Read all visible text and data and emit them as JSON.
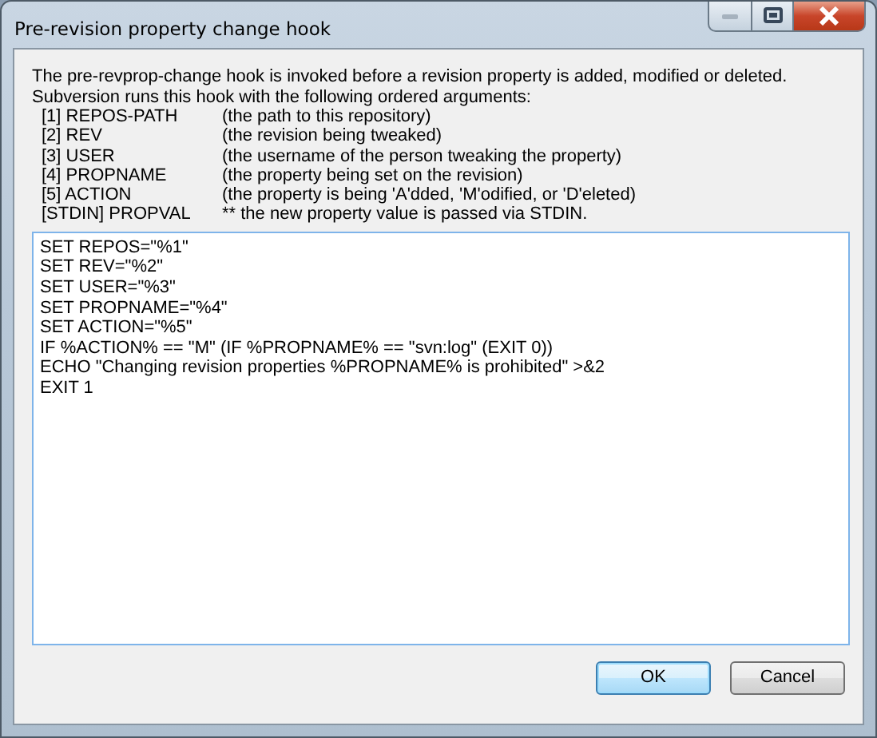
{
  "window": {
    "title": "Pre-revision property change hook",
    "controls": [
      {
        "kind": "minimize",
        "disabled": true
      },
      {
        "kind": "maximize",
        "disabled": false
      },
      {
        "kind": "close",
        "disabled": false
      }
    ]
  },
  "description": [
    "The pre-revprop-change hook is invoked before a revision property is added, modified or deleted.",
    "Subversion runs this hook with the following ordered arguments:"
  ],
  "arguments": [
    {
      "name": "[1] REPOS-PATH",
      "meaning": "(the path to this repository)"
    },
    {
      "name": "[2] REV",
      "meaning": "(the revision being tweaked)"
    },
    {
      "name": "[3] USER",
      "meaning": "(the username of the person tweaking the property)"
    },
    {
      "name": "[4] PROPNAME",
      "meaning": "(the property being set on the revision)"
    },
    {
      "name": "[5] ACTION",
      "meaning": "(the property is being 'A'dded, 'M'odified, or 'D'eleted)"
    },
    {
      "name": "[STDIN] PROPVAL",
      "meaning": "** the new property value is passed via STDIN."
    }
  ],
  "script": {
    "lines": [
      "SET REPOS=\"%1\"",
      "SET REV=\"%2\"",
      "SET USER=\"%3\"",
      "SET PROPNAME=\"%4\"",
      "SET ACTION=\"%5\"",
      "IF %ACTION% == \"M\" (IF %PROPNAME% == \"svn:log\" (EXIT 0))",
      "ECHO \"Changing revision properties %PROPNAME% is prohibited\" >&2",
      "EXIT 1"
    ]
  },
  "buttons": [
    {
      "label": "OK",
      "default": true
    },
    {
      "label": "Cancel",
      "default": false
    }
  ]
}
